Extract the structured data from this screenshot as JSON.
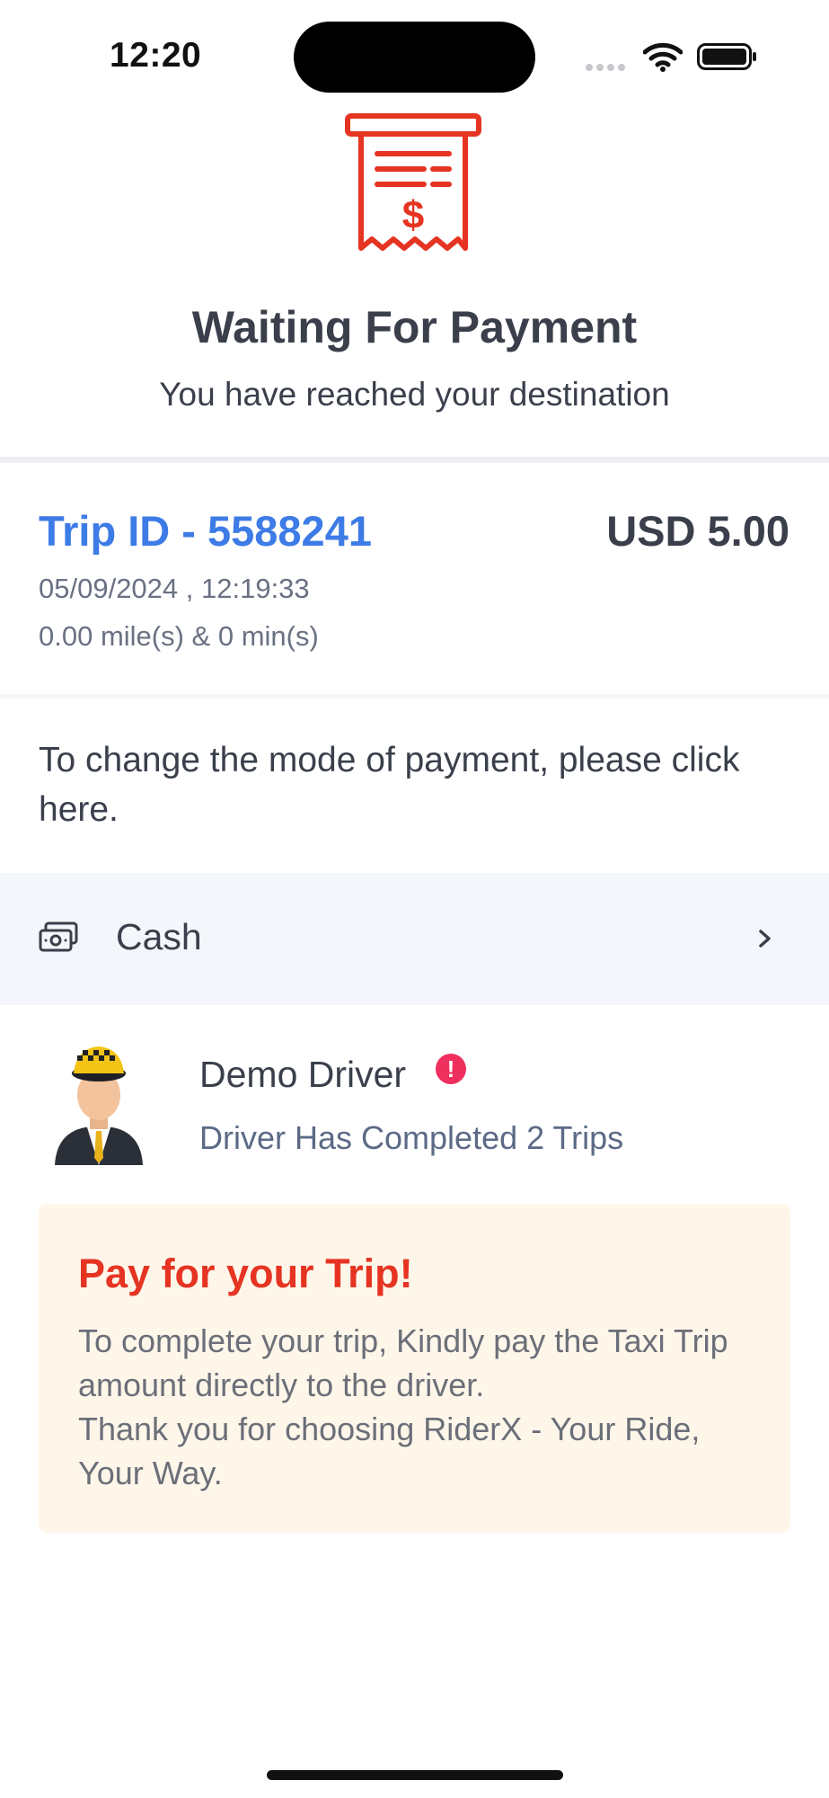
{
  "status_bar": {
    "time": "12:20"
  },
  "header": {
    "icon": "receipt-dollar-icon",
    "title": "Waiting For Payment",
    "subtitle": "You have reached your destination"
  },
  "trip": {
    "id_label": "Trip ID - 5588241",
    "amount": "USD 5.00",
    "datetime": "05/09/2024 , 12:19:33",
    "distance_duration": "0.00 mile(s) & 0 min(s)"
  },
  "payment": {
    "instruction": "To change the mode of payment, please click here.",
    "mode_label": "Cash",
    "mode_icon": "cash-icon"
  },
  "driver": {
    "name": "Demo Driver",
    "alert_glyph": "!",
    "trips_text": "Driver Has Completed 2 Trips"
  },
  "notice": {
    "title": "Pay for your Trip!",
    "body_line1": "To complete your trip, Kindly pay the Taxi Trip amount directly to the driver.",
    "body_line2": "Thank you for choosing RiderX  - Your Ride, Your Way."
  },
  "colors": {
    "accent_blue": "#3d7be6",
    "accent_red": "#e63422",
    "alert_pink": "#ef2f5d",
    "notice_bg": "#fff6ea",
    "payment_row_bg": "#f4f6fb"
  }
}
